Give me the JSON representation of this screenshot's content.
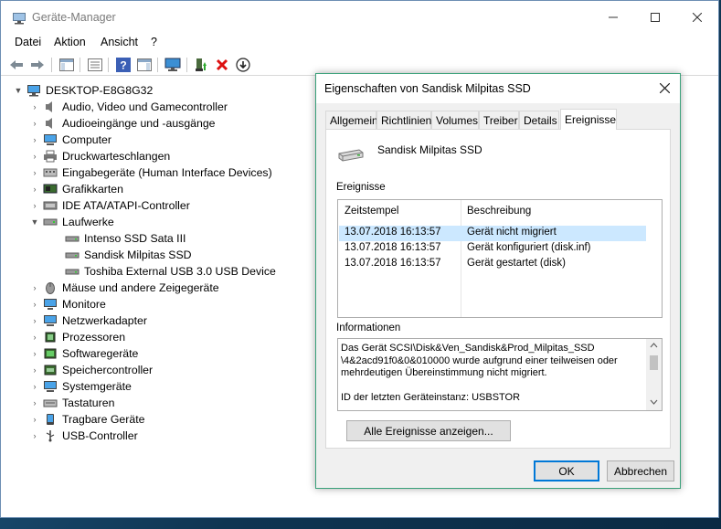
{
  "window": {
    "title": "Geräte-Manager"
  },
  "menu": [
    "Datei",
    "Aktion",
    "Ansicht",
    "?"
  ],
  "toolbar": {
    "icons": [
      "back-arrow-icon",
      "forward-arrow-icon",
      "show-hide-console-tree-icon",
      "properties-icon",
      "help-icon",
      "action-pane-icon",
      "monitor-scan-icon",
      "update-driver-icon",
      "uninstall-icon",
      "disable-device-icon"
    ]
  },
  "tree": {
    "root": "DESKTOP-E8G8G32",
    "categories": [
      {
        "label": "Audio, Video und Gamecontroller",
        "icon": "speaker-icon",
        "expanded": false
      },
      {
        "label": "Audioeingänge und -ausgänge",
        "icon": "speaker-icon",
        "expanded": false
      },
      {
        "label": "Computer",
        "icon": "computer-icon",
        "expanded": false
      },
      {
        "label": "Druckwarteschlangen",
        "icon": "printer-icon",
        "expanded": false
      },
      {
        "label": "Eingabegeräte (Human Interface Devices)",
        "icon": "hid-icon",
        "expanded": false
      },
      {
        "label": "Grafikkarten",
        "icon": "graphics-card-icon",
        "expanded": false
      },
      {
        "label": "IDE ATA/ATAPI-Controller",
        "icon": "ide-controller-icon",
        "expanded": false
      },
      {
        "label": "Laufwerke",
        "icon": "drive-icon",
        "expanded": true,
        "children": [
          "Intenso  SSD Sata III",
          "Sandisk Milpitas SSD",
          "Toshiba External USB 3.0 USB Device"
        ]
      },
      {
        "label": "Mäuse und andere Zeigegeräte",
        "icon": "mouse-icon",
        "expanded": false
      },
      {
        "label": "Monitore",
        "icon": "monitor-icon",
        "expanded": false
      },
      {
        "label": "Netzwerkadapter",
        "icon": "network-adapter-icon",
        "expanded": false
      },
      {
        "label": "Prozessoren",
        "icon": "processor-icon",
        "expanded": false
      },
      {
        "label": "Softwaregeräte",
        "icon": "software-device-icon",
        "expanded": false
      },
      {
        "label": "Speichercontroller",
        "icon": "storage-controller-icon",
        "expanded": false
      },
      {
        "label": "Systemgeräte",
        "icon": "system-device-icon",
        "expanded": false
      },
      {
        "label": "Tastaturen",
        "icon": "keyboard-icon",
        "expanded": false
      },
      {
        "label": "Tragbare Geräte",
        "icon": "portable-device-icon",
        "expanded": false
      },
      {
        "label": "USB-Controller",
        "icon": "usb-icon",
        "expanded": false
      }
    ]
  },
  "dialog": {
    "title": "Eigenschaften von Sandisk Milpitas SSD",
    "tabs": [
      "Allgemein",
      "Richtlinien",
      "Volumes",
      "Treiber",
      "Details",
      "Ereignisse"
    ],
    "active_tab": "Ereignisse",
    "device_name": "Sandisk Milpitas SSD",
    "events_label": "Ereignisse",
    "columns": [
      "Zeitstempel",
      "Beschreibung"
    ],
    "events": [
      {
        "time": "13.07.2018 16:13:57",
        "description": "Gerät nicht migriert",
        "selected": true
      },
      {
        "time": "13.07.2018 16:13:57",
        "description": "Gerät konfiguriert (disk.inf)",
        "selected": false
      },
      {
        "time": "13.07.2018 16:13:57",
        "description": "Gerät gestartet (disk)",
        "selected": false
      }
    ],
    "info_label": "Informationen",
    "info_lines": [
      "Das Gerät SCSI\\Disk&Ven_Sandisk&Prod_Milpitas_SSD",
      "\\4&2acd91f0&0&010000 wurde aufgrund einer teilweisen oder",
      "mehrdeutigen Übereinstimmung nicht migriert.",
      "",
      "ID der letzten Geräteinstanz: USBSTOR"
    ],
    "show_all_button": "Alle Ereignisse anzeigen...",
    "ok_button": "OK",
    "cancel_button": "Abbrechen"
  },
  "colors": {
    "accent": "#0078d7",
    "selection": "#cce8ff",
    "dialog_border": "#3aa17a"
  }
}
